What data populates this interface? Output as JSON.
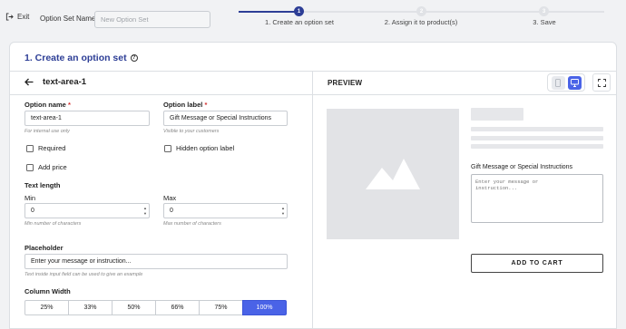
{
  "topbar": {
    "exit_label": "Exit",
    "option_set_name_label": "Option Set Name",
    "option_set_name_placeholder": "New Option Set"
  },
  "steps": [
    {
      "number": "1",
      "label": "1. Create an option set",
      "active": true
    },
    {
      "number": "2",
      "label": "2. Assign it to product(s)",
      "active": false
    },
    {
      "number": "3",
      "label": "3. Save",
      "active": false
    }
  ],
  "card": {
    "title": "1. Create an option set",
    "help_icon": "?"
  },
  "editor": {
    "header_title": "text-area-1",
    "option_name_label": "Option name",
    "option_name_value": "text-area-1",
    "option_name_hint": "For internal use only",
    "option_label_label": "Option label",
    "option_label_value": "Gift Message or Special Instructions",
    "option_label_hint": "Visible to your customers",
    "required_marker": "*",
    "required_label": "Required",
    "hidden_label": "Hidden option label",
    "add_price_label": "Add price",
    "text_length_label": "Text length",
    "min_label": "Min",
    "min_value": "0",
    "min_hint": "Min number of characters",
    "max_label": "Max",
    "max_value": "0",
    "max_hint": "Max number of characters",
    "placeholder_label": "Placeholder",
    "placeholder_value": "Enter your message or instruction...",
    "placeholder_hint": "Text inside input field can be used to give an example",
    "column_width_label": "Column Width",
    "column_width_options": [
      "25%",
      "33%",
      "50%",
      "66%",
      "75%",
      "100%"
    ],
    "column_width_selected": "100%"
  },
  "preview": {
    "title": "PREVIEW",
    "field_label": "Gift Message or Special Instructions",
    "textarea_placeholder": "Enter your message or\ninstruction...",
    "add_to_cart_label": "ADD TO CART",
    "device_selected": "desktop"
  },
  "colors": {
    "accent": "#4a63e7",
    "title_blue": "#2d3e96",
    "required_red": "#d32f2f"
  }
}
